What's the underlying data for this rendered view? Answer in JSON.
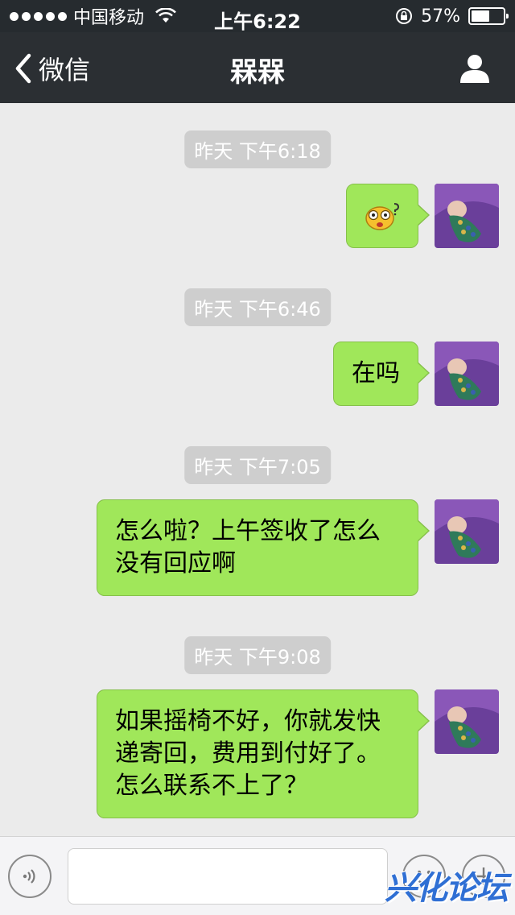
{
  "status_bar": {
    "carrier": "中国移动",
    "time": "上午6:22",
    "battery_percent": "57%",
    "battery_level": 0.57
  },
  "nav": {
    "back_label": "微信",
    "title": "槑槑",
    "profile_icon": "person-icon"
  },
  "messages": [
    {
      "timestamp": "昨天 下午6:18",
      "type": "emoji",
      "emoji_icon": "dizzy-face-emoji-icon"
    },
    {
      "timestamp": "昨天 下午6:46",
      "type": "text",
      "text": "在吗"
    },
    {
      "timestamp": "昨天 下午7:05",
      "type": "text",
      "lines": [
        "怎么啦？上午签收了怎么",
        "没有回应啊"
      ]
    },
    {
      "timestamp": "昨天 下午9:08",
      "type": "text",
      "lines": [
        "如果摇椅不好，你就发快",
        "递寄回，费用到付好了。",
        "怎么联系不上了？"
      ]
    }
  ],
  "input_bar": {
    "voice_icon": "voice-icon",
    "emoji_icon": "emoji-icon",
    "plus_icon": "plus-icon",
    "text_value": ""
  },
  "watermark": "兴化论坛",
  "colors": {
    "bubble_green": "#a0e75a",
    "navbar": "#2b2f33",
    "background": "#ebebeb",
    "watermark": "#2f6fd4"
  }
}
